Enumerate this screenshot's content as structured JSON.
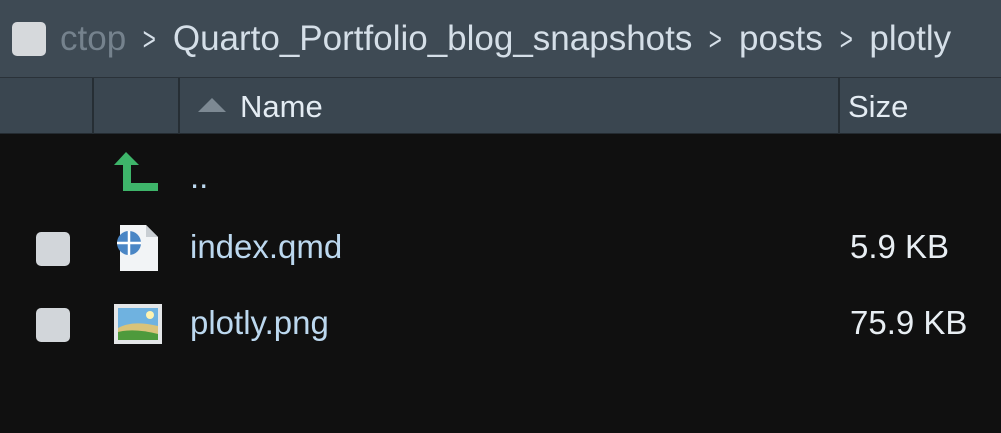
{
  "breadcrumb": {
    "segments": [
      "ctop",
      "Quarto_Portfolio_blog_snapshots",
      "posts",
      "plotly"
    ]
  },
  "header": {
    "name_label": "Name",
    "size_label": "Size"
  },
  "rows": [
    {
      "name": "..",
      "size": "",
      "icon": "parent-dir-up-arrow-icon"
    },
    {
      "name": "index.qmd",
      "size": "5.9 KB",
      "icon": "quarto-file-icon"
    },
    {
      "name": "plotly.png",
      "size": "75.9 KB",
      "icon": "image-file-icon"
    }
  ],
  "colors": {
    "up_arrow": "#3eb56a",
    "row_text": "#bcd8ef",
    "header_bg": "#3a4650"
  }
}
